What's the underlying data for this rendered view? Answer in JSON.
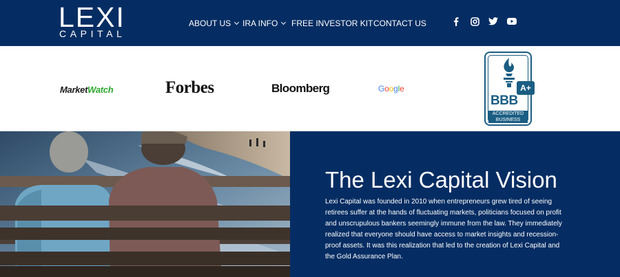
{
  "header": {
    "logo": {
      "main": "LEXI",
      "sub": "CAPITAL"
    },
    "nav": [
      {
        "label": "ABOUT US",
        "has_dropdown": true
      },
      {
        "label": "IRA INFO",
        "has_dropdown": true
      },
      {
        "label": "FREE INVESTOR KIT",
        "has_dropdown": false
      },
      {
        "label": "CONTACT US",
        "has_dropdown": false
      }
    ],
    "social": [
      "facebook-icon",
      "instagram-icon",
      "twitter-icon",
      "youtube-icon"
    ]
  },
  "press": {
    "marketwatch": {
      "part1": "Market",
      "part2": "Watch"
    },
    "forbes": "Forbes",
    "bloomberg": "Bloomberg",
    "google": [
      "G",
      "o",
      "o",
      "g",
      "l",
      "e"
    ],
    "google_colors": [
      "#4285f4",
      "#ea4335",
      "#fbbc05",
      "#4285f4",
      "#34a853",
      "#ea4335"
    ],
    "bbb": {
      "letters": "BBB",
      "rating": "A+",
      "band_line1": "ACCREDITED",
      "band_line2": "BUSINESS"
    }
  },
  "hero": {
    "title": "The Lexi Capital Vision",
    "body": "Lexi Capital was founded in 2010 when entrepreneurs grew tired of seeing retirees suffer at the hands of fluctuating markets, politicians focused on profit and unscrupulous bankers seemingly immune from the law. They immediately realized that everyone should have access to market insights and recession-proof assets. It was this realization that led to the creation of Lexi Capital and the Gold Assurance Plan."
  },
  "colors": {
    "navy": "#062d63",
    "bbb_blue": "#1b5e83",
    "marketwatch_green": "#2ea82e"
  }
}
